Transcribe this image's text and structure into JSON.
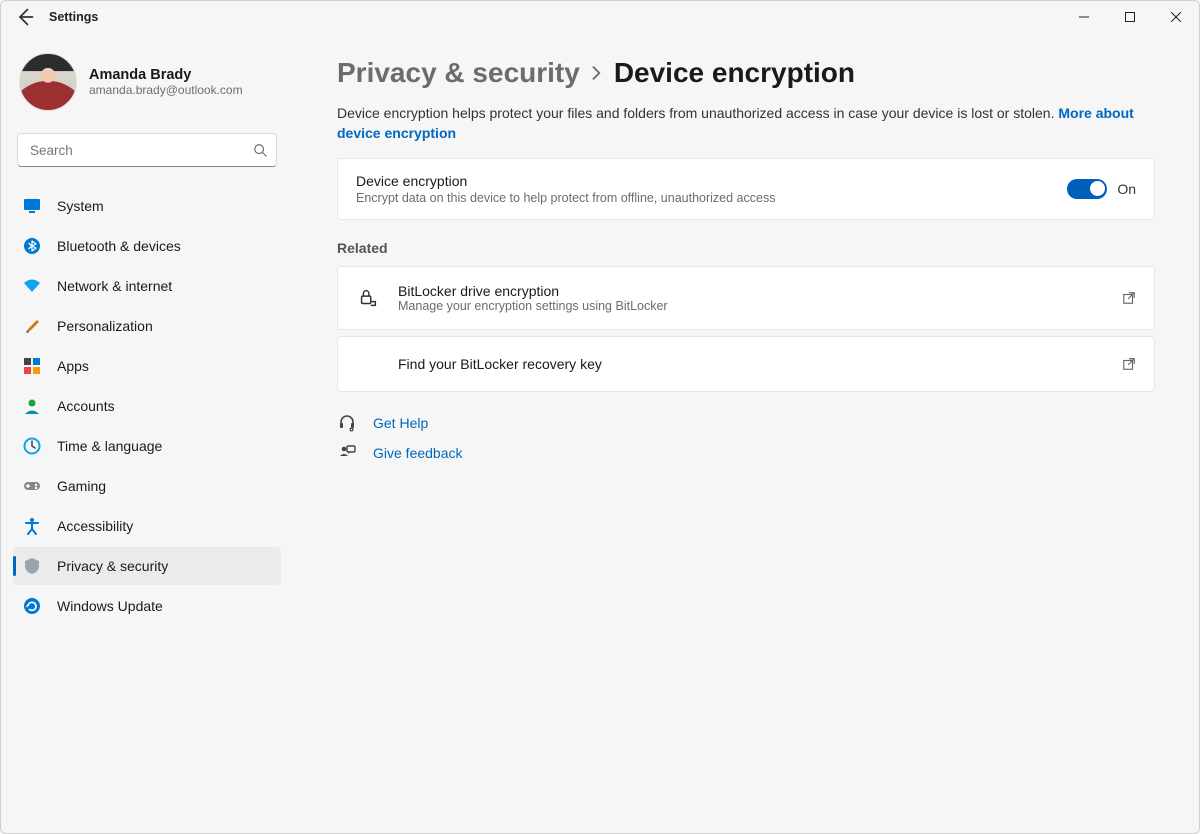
{
  "window_title": "Settings",
  "user": {
    "name": "Amanda Brady",
    "email": "amanda.brady@outlook.com"
  },
  "search": {
    "placeholder": "Search"
  },
  "nav": {
    "items": [
      {
        "label": "System"
      },
      {
        "label": "Bluetooth & devices"
      },
      {
        "label": "Network & internet"
      },
      {
        "label": "Personalization"
      },
      {
        "label": "Apps"
      },
      {
        "label": "Accounts"
      },
      {
        "label": "Time & language"
      },
      {
        "label": "Gaming"
      },
      {
        "label": "Accessibility"
      },
      {
        "label": "Privacy & security"
      },
      {
        "label": "Windows Update"
      }
    ],
    "active_index": 9
  },
  "breadcrumb": {
    "parent": "Privacy & security",
    "current": "Device encryption"
  },
  "description": {
    "text": "Device encryption helps protect your files and folders from unauthorized access in case your device is lost or stolen. ",
    "link": "More about device encryption"
  },
  "encryption_card": {
    "title": "Device encryption",
    "subtitle": "Encrypt data on this device to help protect from offline, unauthorized access",
    "state_label": "On"
  },
  "related": {
    "header": "Related",
    "items": [
      {
        "title": "BitLocker drive encryption",
        "subtitle": "Manage your encryption settings using BitLocker"
      },
      {
        "title": "Find your BitLocker recovery key",
        "subtitle": ""
      }
    ]
  },
  "footer": {
    "help": "Get Help",
    "feedback": "Give feedback"
  }
}
